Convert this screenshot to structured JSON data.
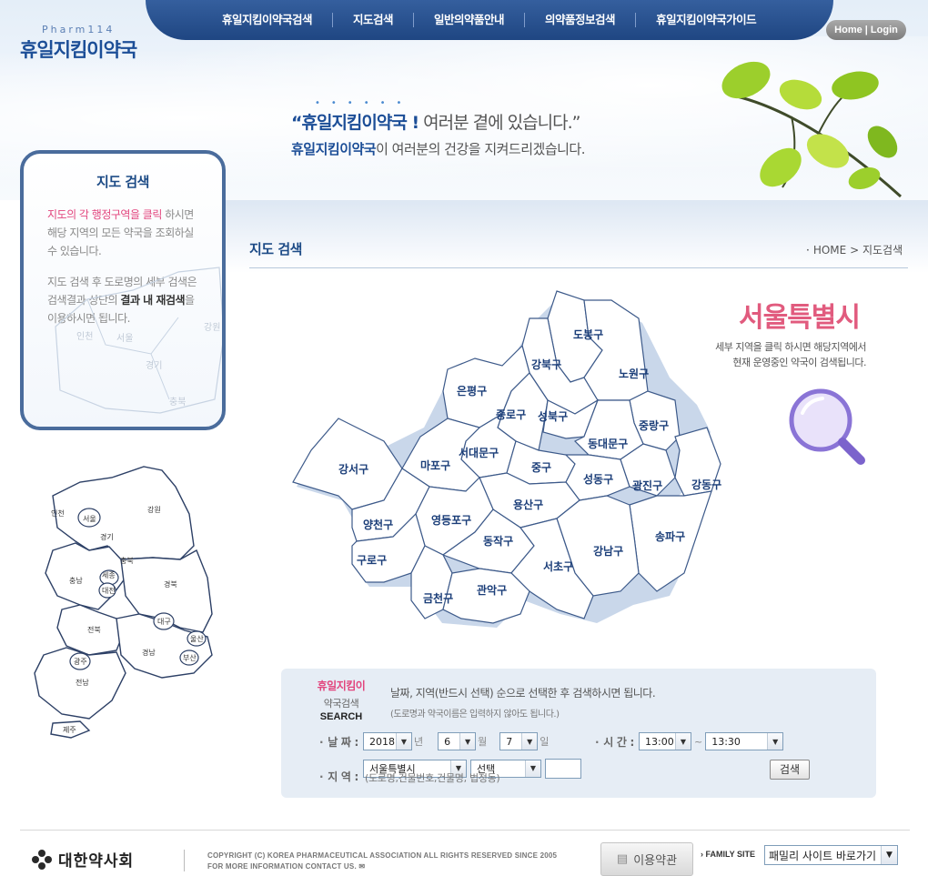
{
  "header": {
    "logo_small": "Pharm114",
    "logo_big": "휴일지킴이약국",
    "nav": [
      "휴일지킴이약국검색",
      "지도검색",
      "일반의약품안내",
      "의약품정보검색",
      "휴일지킴이약국가이드"
    ],
    "home_login": "Home | Login"
  },
  "slogan": {
    "l1_strong": "“휴일지킴이약국 !",
    "l1_rest": " 여러분 곁에 있습니다.”",
    "l2_strong": "휴일지킴이약국",
    "l2_rest": "이 여러분의 건강을 지켜드리겠습니다."
  },
  "left_panel": {
    "title": "지도 검색",
    "desc_hl": "지도의 각 행정구역을 클릭",
    "desc_rest": " 하시면 해당 지역의 모든 약국을 조회하실 수 있습니다.",
    "desc2_a": "지도 검색 후 도로명의 세부 검색은 검색결과 상단의 ",
    "desc2_bold": "결과 내 재검색",
    "desc2_c": "을 이용하시면 됩니다.",
    "bg_regions": [
      "인천",
      "서울",
      "경기",
      "강원",
      "충북"
    ]
  },
  "korea_map": {
    "regions": [
      "인천",
      "서울",
      "경기",
      "강원",
      "충북",
      "충남",
      "세종",
      "대전",
      "경북",
      "대구",
      "전북",
      "울산",
      "경남",
      "부산",
      "광주",
      "전남",
      "제주"
    ]
  },
  "content": {
    "page_title": "지도 검색",
    "breadcrumb_home": "HOME",
    "breadcrumb_sep": ">",
    "breadcrumb_current": "지도검색",
    "city": "서울특별시",
    "city_desc_1": "세부 지역을 클릭 하시면 해당지역에서",
    "city_desc_2": "현재 운영중인 약국이 검색됩니다."
  },
  "seoul_map": {
    "districts": [
      "도봉구",
      "강북구",
      "노원구",
      "은평구",
      "종로구",
      "성북구",
      "중랑구",
      "동대문구",
      "서대문구",
      "강서구",
      "마포구",
      "중구",
      "성동구",
      "광진구",
      "강동구",
      "용산구",
      "양천구",
      "영등포구",
      "동작구",
      "구로구",
      "송파구",
      "강남구",
      "서초구",
      "금천구",
      "관악구"
    ]
  },
  "search": {
    "brand_1": "휴일지킴이",
    "brand_2": "약국검색",
    "brand_3": "SEARCH",
    "guide_1": "날짜, 지역(반드시 선택) 순으로 선택한 후 검색하시면 됩니다.",
    "guide_2": "(도로명과 약국이름은 입력하지 않아도 됩니다.)",
    "date_label": "날 짜 :",
    "year": "2018",
    "year_unit": "년",
    "month": "6",
    "month_unit": "월",
    "day": "7",
    "day_unit": "일",
    "time_label": "시 간 :",
    "time_from": "13:00",
    "time_sep": "~",
    "time_to": "13:30",
    "region_label": "지 역 :",
    "city": "서울특별시",
    "district": "선택",
    "address_hint": "(도로명,건물번호,건물명, 법정동)",
    "search_button": "검색"
  },
  "footer": {
    "org": "대한약사회",
    "copyright_1": "COPYRIGHT (C) KOREA PHARMACEUTICAL ASSOCIATION ALL RIGHTS RESERVED SINCE 2005",
    "copyright_2": "FOR MORE INFORMATION CONTACT US.",
    "terms": "이용약관",
    "family_label": "FAMILY SITE",
    "family_select": "패밀리 사이트 바로가기"
  },
  "colors": {
    "navy": "#1f4682",
    "accent_pink": "#e15b7e",
    "panel_border": "#4a6c9c",
    "map_stroke": "#3d5a8a",
    "search_bg": "#e6edf5"
  }
}
